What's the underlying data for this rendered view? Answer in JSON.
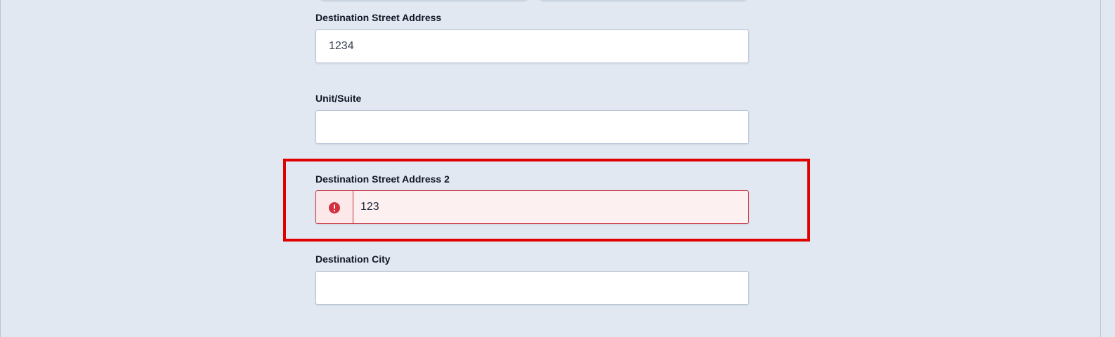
{
  "form": {
    "fields": [
      {
        "label": "Destination Street Address",
        "value": "1234",
        "placeholder": ""
      },
      {
        "label": "Unit/Suite",
        "value": "",
        "placeholder": ""
      },
      {
        "label": "Destination Street Address 2",
        "value": "123",
        "placeholder": "",
        "state": "error",
        "icon": "error-icon"
      },
      {
        "label": "Destination City",
        "value": "",
        "placeholder": ""
      }
    ]
  },
  "colors": {
    "page_background": "#e1e8f1",
    "input_border": "#b7c3d3",
    "error_border": "#c5303f",
    "error_background": "#fcf0f1",
    "error_icon": "#d32f3f",
    "annotation_highlight": "#e00000"
  }
}
